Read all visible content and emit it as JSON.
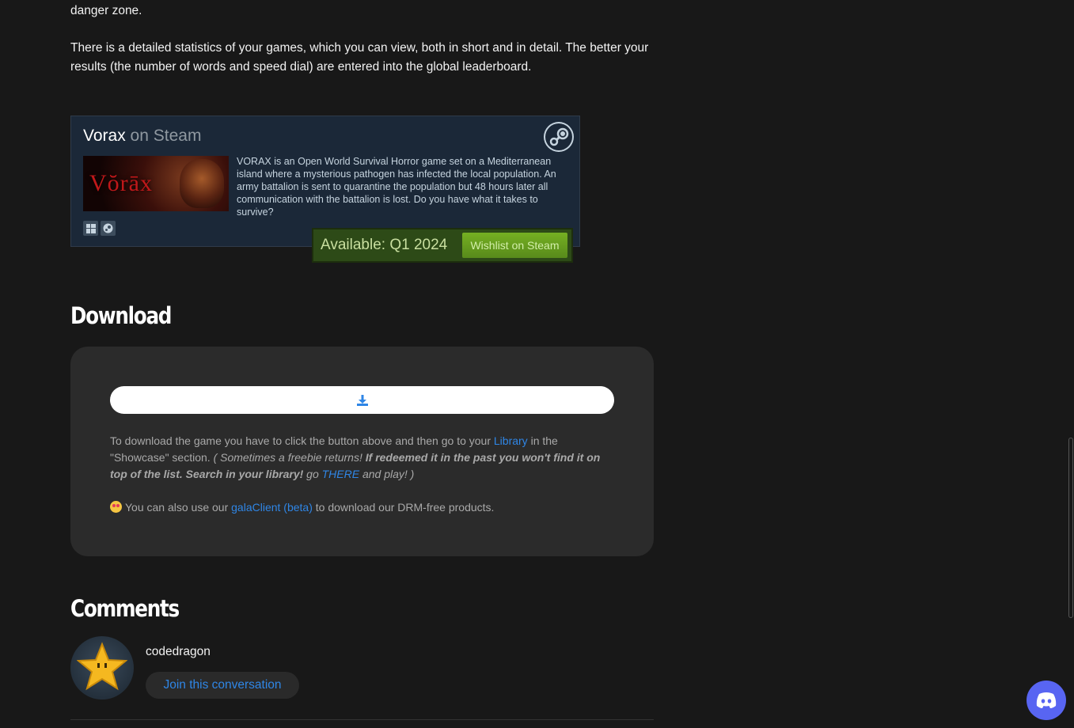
{
  "intro": {
    "p1": "danger zone.",
    "p2": "There is a detailed statistics of your games, which you can view, both in short and in detail. The better your results (the number of words and speed dial) are entered into the global leaderboard."
  },
  "steam_widget": {
    "game_name": "Vorax",
    "on_steam": "on Steam",
    "capsule_logo_text": "Vŏrāx",
    "description": "VORAX is an Open World Survival Horror game set on a Mediterranean island where a mysterious pathogen has infected the local population. An army battalion is sent to quarantine the population but 48 hours later all communication with the battalion is lost. Do you have what it takes to survive?",
    "platforms": [
      "windows-icon",
      "steam-icon"
    ],
    "availability": "Available: Q1 2024",
    "wishlist_label": "Wishlist on Steam",
    "colors": {
      "bg": "#1b2838",
      "purchase_bg": "#2d4a17",
      "button": "#75b022"
    }
  },
  "download": {
    "heading": "Download",
    "button_icon": "download-icon",
    "p1_a": "To download the game you have to click the button above and then go to your ",
    "library_link": "Library",
    "p1_b": " in the \"Showcase\" section. ",
    "p1_italic": "( Sometimes a freebie returns! ",
    "p1_bold": "If redeemed it in the past you won't find it on top of the list. Search in your library!",
    "p1_go": " go ",
    "there_link": "THERE",
    "p1_end": " and play! )",
    "p2_a": "You can also use our ",
    "client_link": "galaClient (beta)",
    "p2_b": " to download our DRM-free products."
  },
  "comments": {
    "heading": "Comments",
    "username": "codedragon",
    "join_label": "Join this conversation"
  },
  "accent_color": "#2f86e6"
}
